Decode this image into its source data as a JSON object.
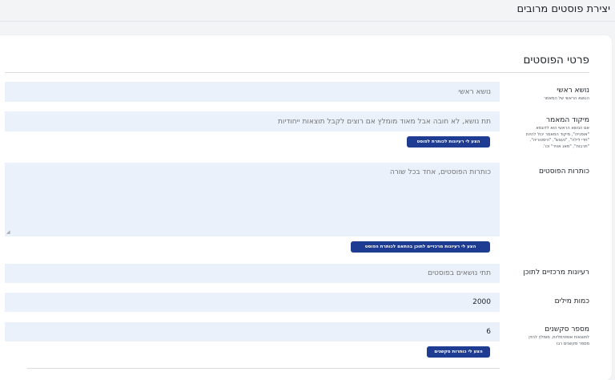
{
  "page": {
    "title": "יצירת פוסטים מרובים"
  },
  "section": {
    "title": "פרטי הפוסטים"
  },
  "fields": {
    "main_topic": {
      "label": "נושא ראשי",
      "sublabel": "הנושא הראשי של המאמר",
      "placeholder": "נושא ראשי"
    },
    "focus": {
      "label": "מיקוד המאמר",
      "sublabel_lines": [
        "אם הנושא הראשי הוא לדוגמא",
        "\"אופנייה\", מיקוד המאמר יכול להיות",
        "\"חדי לילה\", \"נעצש\", \"היסטוריה\",",
        "\"תרבות\", \"מאג אוויר\" וכו'."
      ],
      "placeholder": "תת נושא, לא חובה אבל מאוד מומלץ אם רוצים לקבל תוצאות ייחודיות",
      "button": "הצע לי רעיונות לכותרת לפוסט"
    },
    "titles": {
      "label": "כותרות הפוסטים",
      "placeholder": "כותרות הפוסטים, אחד בכל שורה",
      "button": "הצע לי רעיונות מרכזיים לתוכן בהתאם לכותרת הפוסט"
    },
    "content_ideas": {
      "label": "רעיונות מרכזיים לתוכן",
      "placeholder": "תתי נושאים בפוסטים"
    },
    "word_count": {
      "label": "כמות מילים",
      "value": "2000"
    },
    "sections": {
      "label": "מספר סקשנים",
      "sublabel_lines": [
        "לתוצאות אופטימליות, מומלץ להזין",
        "מספר סקשנים רבו"
      ],
      "value": "6",
      "button": "הצע לי כותרות סקשנים"
    }
  },
  "icons": {
    "resize": "resize-handle-icon"
  },
  "colors": {
    "accent": "#1e3c91",
    "field_bg": "#eaf1fb",
    "page_bg": "#f3f4f6"
  }
}
